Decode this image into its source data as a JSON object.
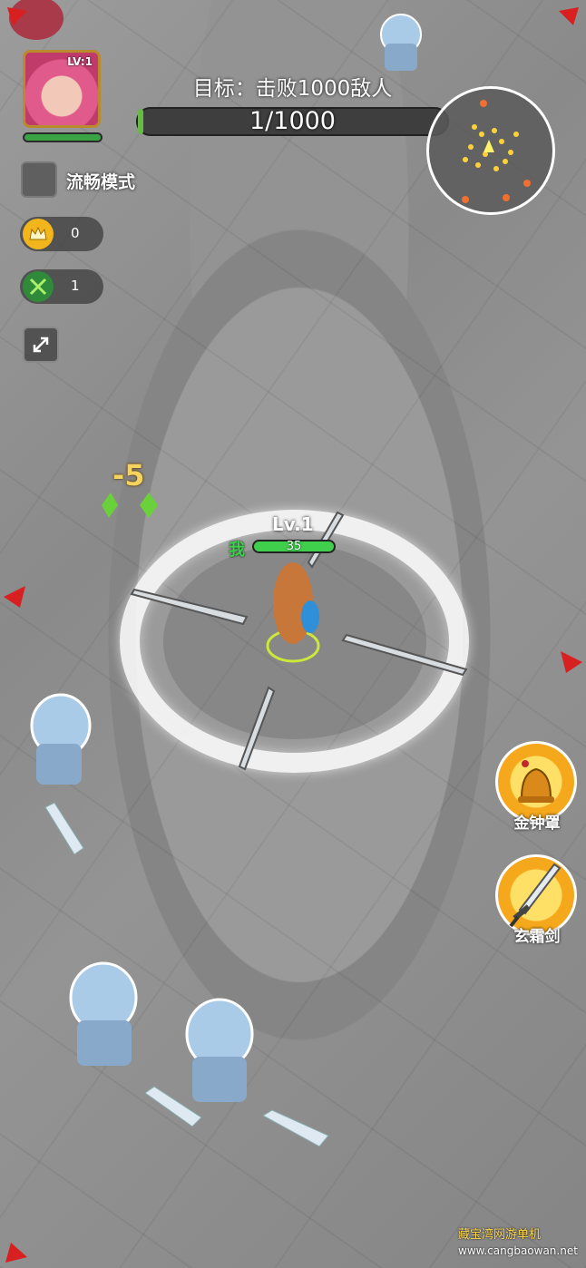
{
  "player": {
    "portrait_level": "LV:1",
    "hp_fraction": 1.0
  },
  "smooth_mode": {
    "label": "流畅模式",
    "checked": false
  },
  "currency": {
    "coins": "0",
    "coin_icon": "crown-coin-icon",
    "swords": "1",
    "sword_icon": "crossed-swords-icon"
  },
  "expand_icon": "expand-arrows-icon",
  "objective": {
    "title": "目标：击败1000敌人",
    "progress_text": "1/1000",
    "progress_fraction": 0.001
  },
  "character": {
    "level_label": "Lv.1",
    "me_tag": "我",
    "hp_text": "35",
    "hp_fraction": 1.0
  },
  "damage_popup": "-5",
  "skills": [
    {
      "name": "金钟罩",
      "icon": "golden-bell-icon"
    },
    {
      "name": "玄霜剑",
      "icon": "frost-sword-icon"
    }
  ],
  "watermark": {
    "brand": "藏宝湾网游单机",
    "url": "www.cangbaowan.net"
  },
  "colors": {
    "accent_green": "#3fcf4c",
    "gold": "#f4d35e",
    "edge_arrow": "#d82020"
  }
}
